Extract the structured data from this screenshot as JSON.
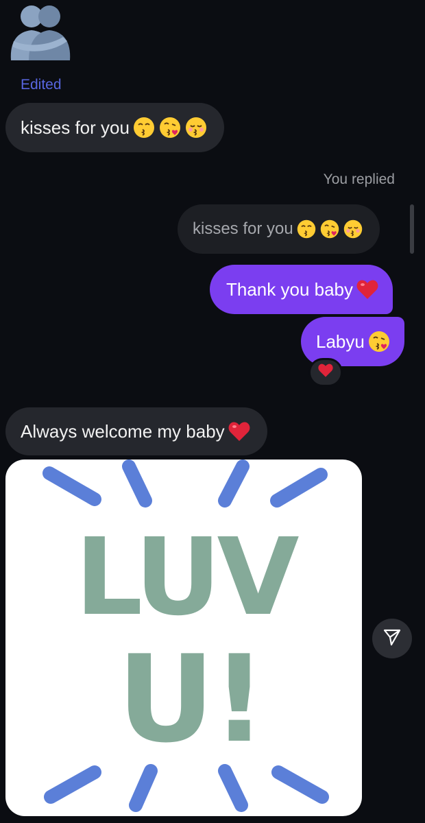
{
  "thread": {
    "edited_label": "Edited",
    "replied_label": "You replied",
    "messages": [
      {
        "text": "kisses for you",
        "emojis": [
          "kissing",
          "kiss-heart",
          "kissing-smile"
        ]
      },
      {
        "text": "kisses for you",
        "emojis": [
          "kissing",
          "kiss-heart",
          "kissing-smile"
        ]
      },
      {
        "text": "Thank you baby",
        "emojis": [
          "red-heart"
        ]
      },
      {
        "text": "Labyu",
        "emojis": [
          "kiss-heart"
        ]
      },
      {
        "text": "Always welcome my baby",
        "emojis": [
          "red-heart"
        ]
      }
    ],
    "reaction": "❤️",
    "sticker": {
      "line1": "LUV",
      "line2": "U!",
      "text_color": "#85aa99",
      "ray_color": "#5b7fd8"
    }
  },
  "colors": {
    "background": "#0b0d12",
    "incoming_bubble": "#25272d",
    "outgoing_bubble": "#7b3ef0",
    "edited_label": "#5866e0"
  },
  "icons": {
    "avatar": "people-hugging-icon",
    "share": "paper-plane-icon"
  }
}
